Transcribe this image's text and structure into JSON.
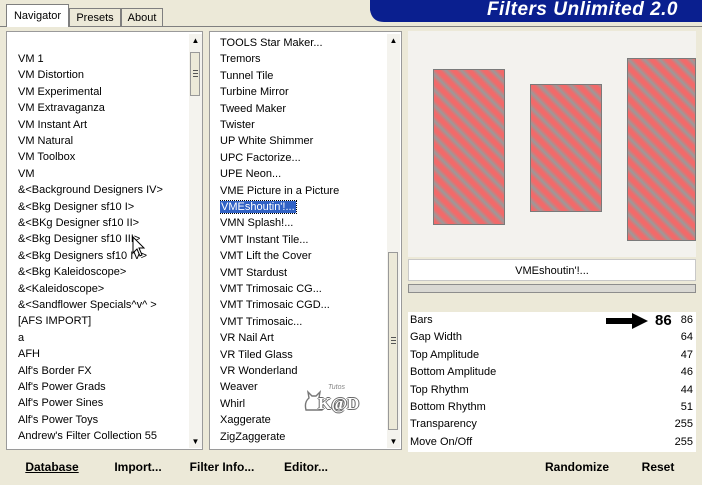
{
  "tabs": [
    {
      "label": "Navigator",
      "active": true
    },
    {
      "label": "Presets",
      "active": false
    },
    {
      "label": "About",
      "active": false
    }
  ],
  "app_title": "Filters Unlimited 2.0",
  "categories": [
    "VM 1",
    "VM Distortion",
    "VM Experimental",
    "VM Extravaganza",
    "VM Instant Art",
    "VM Natural",
    "VM Toolbox",
    "VM",
    "&<Background Designers IV>",
    "&<Bkg Designer sf10 I>",
    "&<BKg Designer sf10 II>",
    "&<Bkg Designer sf10 III>",
    "&<Bkg Designers sf10 IV>",
    "&<Bkg Kaleidoscope>",
    "&<Kaleidoscope>",
    "&<Sandflower Specials^v^ >",
    "[AFS IMPORT]",
    "a",
    "AFH",
    "Alf's Border FX",
    "Alf's Power Grads",
    "Alf's Power Sines",
    "Alf's Power Toys",
    "Andrew's Filter Collection 55"
  ],
  "filters": [
    "TOOLS Star Maker...",
    "Tremors",
    "Tunnel Tile",
    "Turbine Mirror",
    "Tweed Maker",
    "Twister",
    "UP White Shimmer",
    "UPC Factorize...",
    "UPE Neon...",
    "VME Picture in a Picture",
    "VMEshoutin'!...",
    "VMN Splash!...",
    "VMT Instant Tile...",
    "VMT Lift the Cover",
    "VMT Stardust",
    "VMT Trimosaic CG...",
    "VMT Trimosaic CGD...",
    "VMT Trimosaic...",
    "VR Nail Art",
    "VR Tiled Glass",
    "VR Wonderland",
    "Weaver",
    "Whirl",
    "Xaggerate",
    "ZigZaggerate"
  ],
  "selected_filter_index": 10,
  "filter_name": "VMEshoutin'!...",
  "params": [
    {
      "label": "Bars",
      "value": "86"
    },
    {
      "label": "Gap Width",
      "value": "64"
    },
    {
      "label": "Top Amplitude",
      "value": "47"
    },
    {
      "label": "Bottom Amplitude",
      "value": "46"
    },
    {
      "label": "Top Rhythm",
      "value": "44"
    },
    {
      "label": "Bottom Rhythm",
      "value": "51"
    },
    {
      "label": "Transparency",
      "value": "255"
    },
    {
      "label": "Move On/Off",
      "value": "255"
    }
  ],
  "annotation_value": "86",
  "watermark": {
    "small": "Tutos",
    "main": "K@D"
  },
  "buttons": {
    "database": "Database",
    "import": "Import...",
    "filter_info": "Filter Info...",
    "editor": "Editor...",
    "randomize": "Randomize",
    "reset": "Reset"
  },
  "colors": {
    "banner": "#0a1f8f",
    "selection": "#3162c5",
    "preview_gradient_a": "#f26a6a",
    "preview_gradient_b": "#9a9a9a"
  }
}
